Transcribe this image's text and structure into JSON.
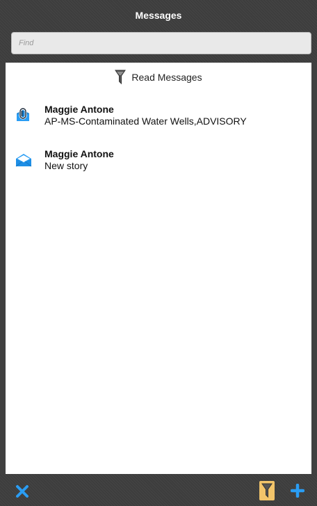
{
  "header": {
    "title": "Messages",
    "search": {
      "placeholder": "Find",
      "value": ""
    }
  },
  "filter": {
    "label": "Read Messages",
    "icon": "funnel-icon"
  },
  "messages": [
    {
      "sender": "Maggie Antone",
      "subject": "AP-MS-Contaminated Water Wells,ADVISORY",
      "icon": "attachment-icon"
    },
    {
      "sender": "Maggie Antone",
      "subject": "New story",
      "icon": "open-envelope-icon"
    }
  ],
  "footer": {
    "close_icon": "close-icon",
    "filter_icon": "funnel-icon",
    "add_icon": "add-icon"
  },
  "colors": {
    "chrome": "#3d3d3d",
    "accent": "#2a9df4",
    "filter_active": "#f2c46a"
  }
}
